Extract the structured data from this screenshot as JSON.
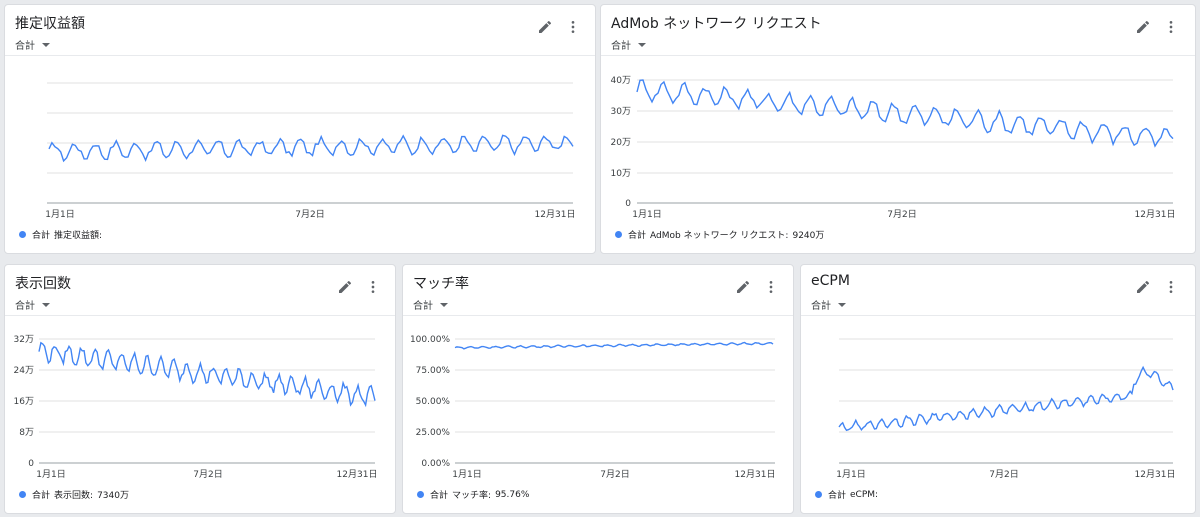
{
  "accent_color": "#4285f4",
  "cards": [
    {
      "title": "推定収益額",
      "aggregation": "合計",
      "y_ticks": [],
      "x_ticks": [
        "1月1日",
        "7月2日",
        "12月31日"
      ],
      "legend_agg": "合計",
      "legend_label": "推定収益額:",
      "legend_value": "",
      "chart_data": {
        "type": "line",
        "x": [
          "1月1日",
          "7月2日",
          "12月31日"
        ],
        "series": [
          {
            "name": "推定収益額",
            "trend_start": 0.43,
            "trend_end": 0.5,
            "amplitude": 0.09
          }
        ]
      }
    },
    {
      "title": "AdMob ネットワーク リクエスト",
      "aggregation": "合計",
      "y_ticks": [
        "40万",
        "30万",
        "20万",
        "10万",
        "0"
      ],
      "x_ticks": [
        "1月1日",
        "7月2日",
        "12月31日"
      ],
      "legend_agg": "合計",
      "legend_label": "AdMob ネットワーク リクエスト:",
      "legend_value": "9240万",
      "chart_data": {
        "type": "line",
        "x": [
          "1月1日",
          "7月2日",
          "12月31日"
        ],
        "ylim": [
          0,
          400000
        ],
        "series": [
          {
            "name": "AdMob ネットワーク リクエスト",
            "start": 370000,
            "end": 210000,
            "amplitude": 40000
          }
        ]
      }
    },
    {
      "title": "表示回数",
      "aggregation": "合計",
      "y_ticks": [
        "32万",
        "24万",
        "16万",
        "8万",
        "0"
      ],
      "x_ticks": [
        "1月1日",
        "7月2日",
        "12月31日"
      ],
      "legend_agg": "合計",
      "legend_label": "表示回数:",
      "legend_value": "7340万",
      "chart_data": {
        "type": "line",
        "x": [
          "1月1日",
          "7月2日",
          "12月31日"
        ],
        "ylim": [
          0,
          320000
        ],
        "series": [
          {
            "name": "表示回数",
            "start": 290000,
            "end": 170000,
            "amplitude": 30000
          }
        ]
      }
    },
    {
      "title": "マッチ率",
      "aggregation": "合計",
      "y_ticks": [
        "100.00%",
        "75.00%",
        "50.00%",
        "25.00%",
        "0.00%"
      ],
      "x_ticks": [
        "1月1日",
        "7月2日",
        "12月31日"
      ],
      "legend_agg": "合計",
      "legend_label": "マッチ率:",
      "legend_value": "95.76%",
      "chart_data": {
        "type": "line",
        "x": [
          "1月1日",
          "7月2日",
          "12月31日"
        ],
        "ylim": [
          0,
          100
        ],
        "series": [
          {
            "name": "マッチ率",
            "start": 93,
            "end": 96.5,
            "amplitude": 1
          }
        ]
      }
    },
    {
      "title": "eCPM",
      "aggregation": "合計",
      "y_ticks": [],
      "x_ticks": [
        "1月1日",
        "7月2日",
        "12月31日"
      ],
      "legend_agg": "合計",
      "legend_label": "eCPM:",
      "legend_value": "",
      "chart_data": {
        "type": "line",
        "x": [
          "1月1日",
          "7月2日",
          "12月31日"
        ],
        "series": [
          {
            "name": "eCPM",
            "trend_start": 0.28,
            "trend_end": 0.58,
            "amplitude": 0.05
          }
        ]
      }
    }
  ]
}
